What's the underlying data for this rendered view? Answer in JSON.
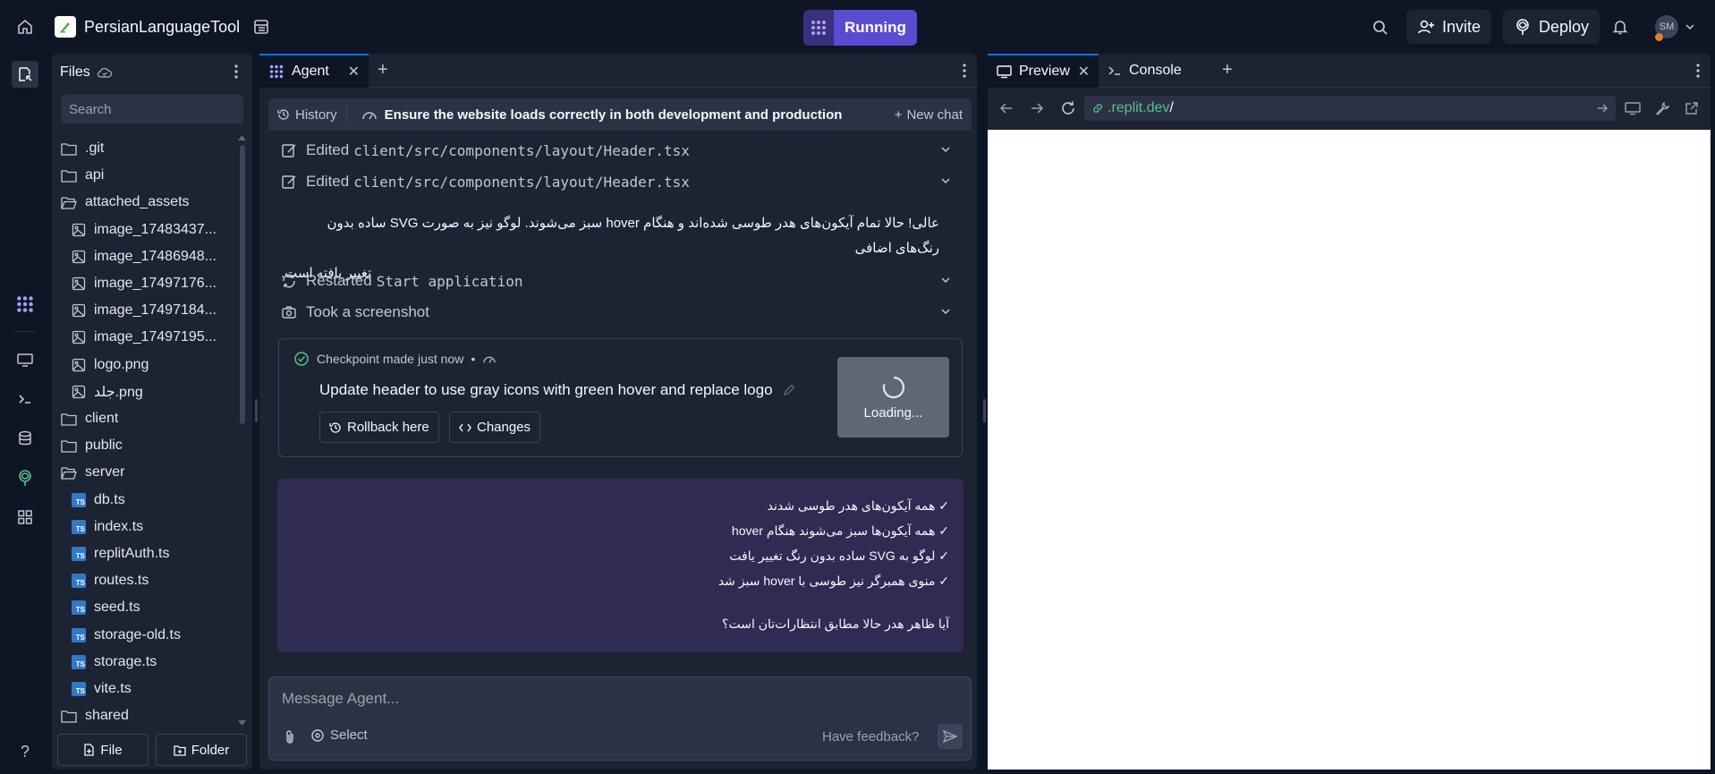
{
  "topbar": {
    "project_name": "PersianLanguageTool",
    "run_label": "Running",
    "invite_label": "Invite",
    "deploy_label": "Deploy",
    "avatar_initials": "SM"
  },
  "files_panel": {
    "title": "Files",
    "search_placeholder": "Search",
    "items": [
      {
        "name": ".git",
        "type": "folder"
      },
      {
        "name": "api",
        "type": "folder"
      },
      {
        "name": "attached_assets",
        "type": "folder-open"
      },
      {
        "name": "image_17483437...",
        "type": "image"
      },
      {
        "name": "image_17486948...",
        "type": "image"
      },
      {
        "name": "image_17497176...",
        "type": "image"
      },
      {
        "name": "image_17497184...",
        "type": "image"
      },
      {
        "name": "image_17497195...",
        "type": "image"
      },
      {
        "name": "logo.png",
        "type": "image"
      },
      {
        "name": "جلد.png",
        "type": "image"
      },
      {
        "name": "client",
        "type": "folder"
      },
      {
        "name": "public",
        "type": "folder"
      },
      {
        "name": "server",
        "type": "folder-open"
      },
      {
        "name": "db.ts",
        "type": "ts"
      },
      {
        "name": "index.ts",
        "type": "ts"
      },
      {
        "name": "replitAuth.ts",
        "type": "ts"
      },
      {
        "name": "routes.ts",
        "type": "ts"
      },
      {
        "name": "seed.ts",
        "type": "ts"
      },
      {
        "name": "storage-old.ts",
        "type": "ts"
      },
      {
        "name": "storage.ts",
        "type": "ts"
      },
      {
        "name": "vite.ts",
        "type": "ts"
      },
      {
        "name": "shared",
        "type": "folder"
      }
    ],
    "new_file_label": "File",
    "new_folder_label": "Folder"
  },
  "agent_panel": {
    "tab_label": "Agent",
    "history_label": "History",
    "chat_title": "Ensure the website loads correctly in both development and production",
    "new_chat_label": "New chat",
    "actions": [
      {
        "verb": "Edited",
        "target": "client/src/components/layout/Header.tsx"
      },
      {
        "verb": "Edited",
        "target": "client/src/components/layout/Header.tsx"
      }
    ],
    "message_rtl_line1": "عالی! حالا تمام آیکون‌های هدر طوسی شده‌اند و هنگام hover سبز می‌شوند. لوگو نیز به صورت SVG ساده بدون رنگ‌های اضافی",
    "message_rtl_line2": "تغییر یافته است.",
    "restart_verb": "Restarted",
    "restart_target": "Start application",
    "screenshot_label": "Took a screenshot",
    "checkpoint": {
      "made_label": "Checkpoint made",
      "time": "just now",
      "title": "Update header to use gray icons with green hover and replace logo",
      "rollback_label": "Rollback here",
      "changes_label": "Changes",
      "loading_label": "Loading..."
    },
    "summary": {
      "items": [
        "✓ همه آیکون‌های هدر طوسی شدند",
        "✓ همه آیکون‌ها سبز می‌شوند هنگام hover",
        "✓ لوگو به SVG ساده بدون رنگ تغییر یافت",
        "✓ منوی همبرگر نیز طوسی با hover سبز شد"
      ],
      "question": "آیا ظاهر هدر حالا مطابق انتظارات‌تان است؟"
    },
    "input_placeholder": "Message Agent...",
    "select_label": "Select",
    "feedback_label": "Have feedback?"
  },
  "preview_panel": {
    "tab_preview": "Preview",
    "tab_console": "Console",
    "url_domain": ".replit.dev",
    "url_path": "/"
  },
  "colors": {
    "bg": "#0e1525",
    "panel": "#1c2333",
    "accent_purple": "#5b4bd1",
    "summary_bg": "#2f2b52",
    "link_green": "#58c08a"
  }
}
